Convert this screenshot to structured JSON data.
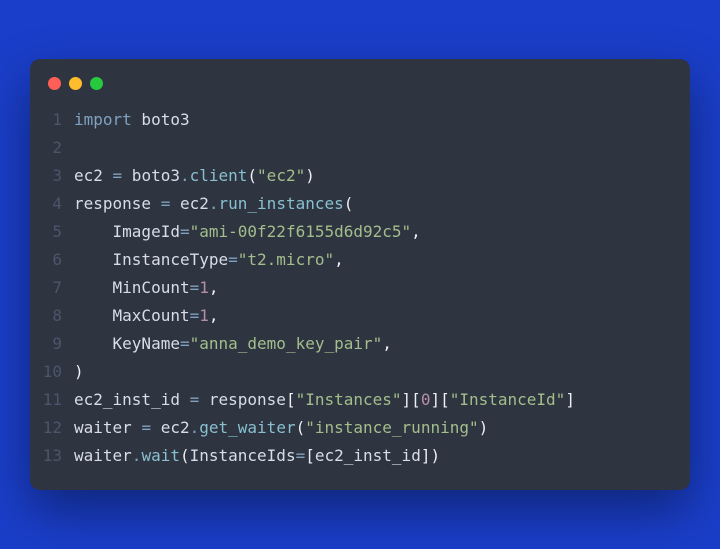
{
  "lines": [
    {
      "n": "1",
      "t": [
        [
          "kw",
          "import"
        ],
        [
          "",
          ""
        ],
        [
          "mod",
          " boto3"
        ]
      ]
    },
    {
      "n": "2",
      "t": []
    },
    {
      "n": "3",
      "t": [
        [
          "var",
          "ec2 "
        ],
        [
          "op",
          "="
        ],
        [
          "var",
          " boto3"
        ],
        [
          "op",
          "."
        ],
        [
          "fn",
          "client"
        ],
        [
          "pun",
          "("
        ],
        [
          "str",
          "\"ec2\""
        ],
        [
          "pun",
          ")"
        ]
      ]
    },
    {
      "n": "4",
      "t": [
        [
          "var",
          "response "
        ],
        [
          "op",
          "="
        ],
        [
          "var",
          " ec2"
        ],
        [
          "op",
          "."
        ],
        [
          "fn",
          "run_instances"
        ],
        [
          "pun",
          "("
        ]
      ]
    },
    {
      "n": "5",
      "t": [
        [
          "var",
          "    ImageId"
        ],
        [
          "op",
          "="
        ],
        [
          "str",
          "\"ami-00f22f6155d6d92c5\""
        ],
        [
          "pun",
          ","
        ]
      ]
    },
    {
      "n": "6",
      "t": [
        [
          "var",
          "    InstanceType"
        ],
        [
          "op",
          "="
        ],
        [
          "str",
          "\"t2.micro\""
        ],
        [
          "pun",
          ","
        ]
      ]
    },
    {
      "n": "7",
      "t": [
        [
          "var",
          "    MinCount"
        ],
        [
          "op",
          "="
        ],
        [
          "num",
          "1"
        ],
        [
          "pun",
          ","
        ]
      ]
    },
    {
      "n": "8",
      "t": [
        [
          "var",
          "    MaxCount"
        ],
        [
          "op",
          "="
        ],
        [
          "num",
          "1"
        ],
        [
          "pun",
          ","
        ]
      ]
    },
    {
      "n": "9",
      "t": [
        [
          "var",
          "    KeyName"
        ],
        [
          "op",
          "="
        ],
        [
          "str",
          "\"anna_demo_key_pair\""
        ],
        [
          "pun",
          ","
        ]
      ]
    },
    {
      "n": "10",
      "t": [
        [
          "pun",
          ")"
        ]
      ]
    },
    {
      "n": "11",
      "t": [
        [
          "var",
          "ec2_inst_id "
        ],
        [
          "op",
          "="
        ],
        [
          "var",
          " response"
        ],
        [
          "pun",
          "["
        ],
        [
          "str",
          "\"Instances\""
        ],
        [
          "pun",
          "]["
        ],
        [
          "num",
          "0"
        ],
        [
          "pun",
          "]["
        ],
        [
          "str",
          "\"InstanceId\""
        ],
        [
          "pun",
          "]"
        ]
      ]
    },
    {
      "n": "12",
      "t": [
        [
          "var",
          "waiter "
        ],
        [
          "op",
          "="
        ],
        [
          "var",
          " ec2"
        ],
        [
          "op",
          "."
        ],
        [
          "fn",
          "get_waiter"
        ],
        [
          "pun",
          "("
        ],
        [
          "str",
          "\"instance_running\""
        ],
        [
          "pun",
          ")"
        ]
      ]
    },
    {
      "n": "13",
      "t": [
        [
          "var",
          "waiter"
        ],
        [
          "op",
          "."
        ],
        [
          "fn",
          "wait"
        ],
        [
          "pun",
          "("
        ],
        [
          "var",
          "InstanceIds"
        ],
        [
          "op",
          "="
        ],
        [
          "pun",
          "["
        ],
        [
          "var",
          "ec2_inst_id"
        ],
        [
          "pun",
          "])"
        ]
      ]
    }
  ]
}
